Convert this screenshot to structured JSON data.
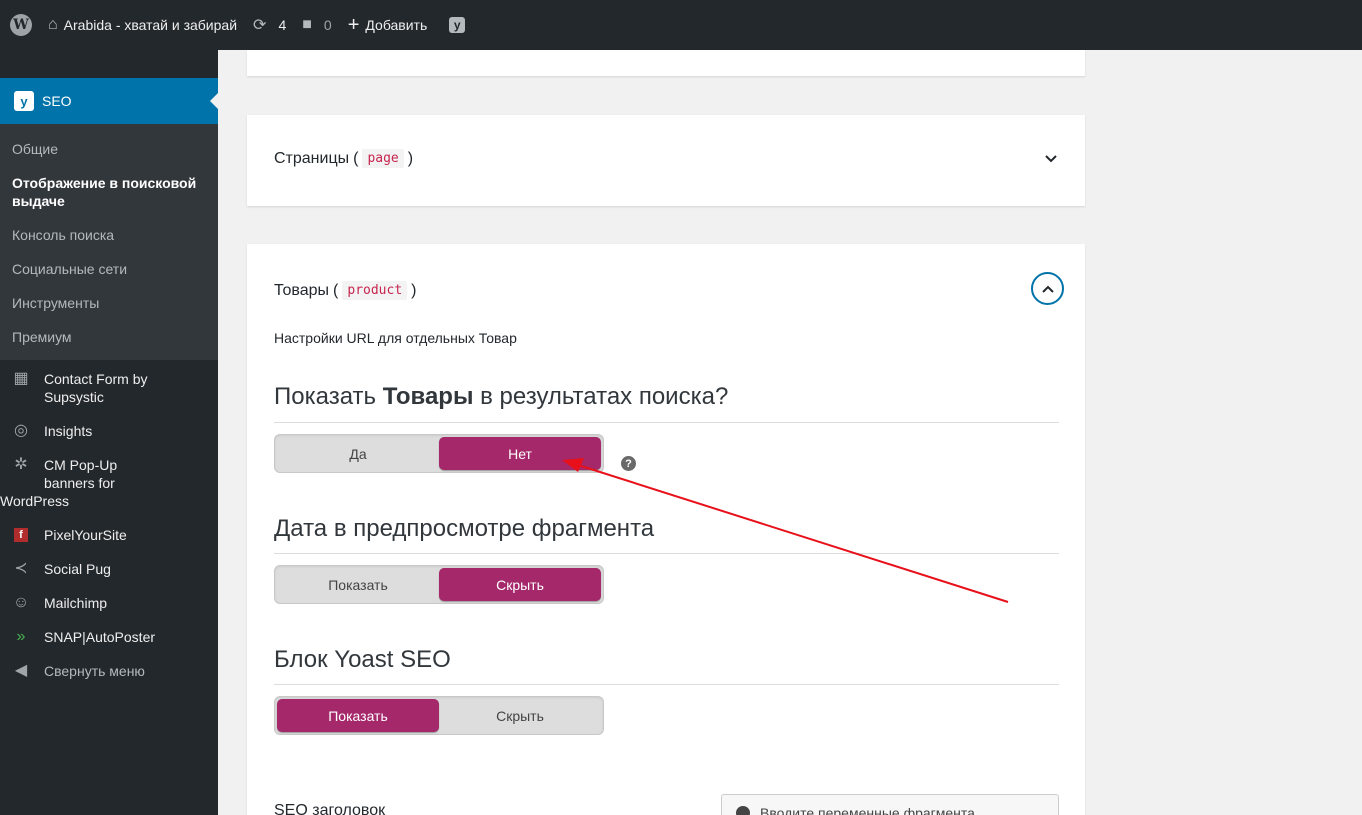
{
  "admin_bar": {
    "site_name": "Arabida - хватай и забирай",
    "updates_count": "4",
    "comments_count": "0",
    "add_label": "Добавить"
  },
  "sidebar": {
    "seo_label": "SEO",
    "submenu": [
      {
        "label": "Общие"
      },
      {
        "label": "Отображение в поисковой выдаче"
      },
      {
        "label": "Консоль поиска"
      },
      {
        "label": "Социальные сети"
      },
      {
        "label": "Инструменты"
      },
      {
        "label": "Премиум"
      }
    ],
    "items": [
      {
        "label": "Contact Form by Supsystic",
        "icon": "table-grid-icon"
      },
      {
        "label": "Insights",
        "icon": "insights-icon"
      },
      {
        "label_line1": "CM Pop-Up",
        "label_line2": "banners for",
        "label_line3": "WordPress",
        "icon": "gear-icon"
      },
      {
        "label": "PixelYourSite",
        "icon": "pixelyoursite-icon"
      },
      {
        "label": "Social Pug",
        "icon": "share-icon"
      },
      {
        "label": "Mailchimp",
        "icon": "mailchimp-icon"
      },
      {
        "label": "SNAP|AutoPoster",
        "icon": "snap-arrow-icon"
      },
      {
        "label": "Свернуть меню",
        "icon": "collapse-icon"
      }
    ]
  },
  "pages_panel": {
    "title": "Страницы",
    "code": "page"
  },
  "products_panel": {
    "title": "Товары",
    "code": "product",
    "subtitle": "Настройки URL для отдельных Товар",
    "q1": {
      "prefix": "Показать ",
      "bold": "Товары",
      "suffix": " в результатах поиска?",
      "yes": "Да",
      "no": "Нет"
    },
    "q2": {
      "title": "Дата в предпросмотре фрагмента",
      "show": "Показать",
      "hide": "Скрыть"
    },
    "q3": {
      "title": "Блок Yoast SEO",
      "show": "Показать",
      "hide": "Скрыть"
    },
    "seo_title_label": "SEO заголовок",
    "insert_var_label": "Вводите переменные фрагмента"
  },
  "colors": {
    "admin_bar": "#23282d",
    "accent_blue": "#0073aa",
    "toggle_active": "#a4286a",
    "annotation_arrow": "#e8101a"
  }
}
